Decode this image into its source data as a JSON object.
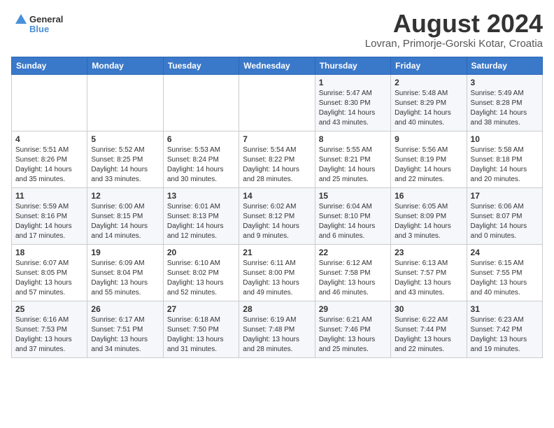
{
  "header": {
    "logo_line1": "General",
    "logo_line2": "Blue",
    "month_year": "August 2024",
    "location": "Lovran, Primorje-Gorski Kotar, Croatia"
  },
  "weekdays": [
    "Sunday",
    "Monday",
    "Tuesday",
    "Wednesday",
    "Thursday",
    "Friday",
    "Saturday"
  ],
  "weeks": [
    [
      {
        "day": "",
        "info": ""
      },
      {
        "day": "",
        "info": ""
      },
      {
        "day": "",
        "info": ""
      },
      {
        "day": "",
        "info": ""
      },
      {
        "day": "1",
        "info": "Sunrise: 5:47 AM\nSunset: 8:30 PM\nDaylight: 14 hours\nand 43 minutes."
      },
      {
        "day": "2",
        "info": "Sunrise: 5:48 AM\nSunset: 8:29 PM\nDaylight: 14 hours\nand 40 minutes."
      },
      {
        "day": "3",
        "info": "Sunrise: 5:49 AM\nSunset: 8:28 PM\nDaylight: 14 hours\nand 38 minutes."
      }
    ],
    [
      {
        "day": "4",
        "info": "Sunrise: 5:51 AM\nSunset: 8:26 PM\nDaylight: 14 hours\nand 35 minutes."
      },
      {
        "day": "5",
        "info": "Sunrise: 5:52 AM\nSunset: 8:25 PM\nDaylight: 14 hours\nand 33 minutes."
      },
      {
        "day": "6",
        "info": "Sunrise: 5:53 AM\nSunset: 8:24 PM\nDaylight: 14 hours\nand 30 minutes."
      },
      {
        "day": "7",
        "info": "Sunrise: 5:54 AM\nSunset: 8:22 PM\nDaylight: 14 hours\nand 28 minutes."
      },
      {
        "day": "8",
        "info": "Sunrise: 5:55 AM\nSunset: 8:21 PM\nDaylight: 14 hours\nand 25 minutes."
      },
      {
        "day": "9",
        "info": "Sunrise: 5:56 AM\nSunset: 8:19 PM\nDaylight: 14 hours\nand 22 minutes."
      },
      {
        "day": "10",
        "info": "Sunrise: 5:58 AM\nSunset: 8:18 PM\nDaylight: 14 hours\nand 20 minutes."
      }
    ],
    [
      {
        "day": "11",
        "info": "Sunrise: 5:59 AM\nSunset: 8:16 PM\nDaylight: 14 hours\nand 17 minutes."
      },
      {
        "day": "12",
        "info": "Sunrise: 6:00 AM\nSunset: 8:15 PM\nDaylight: 14 hours\nand 14 minutes."
      },
      {
        "day": "13",
        "info": "Sunrise: 6:01 AM\nSunset: 8:13 PM\nDaylight: 14 hours\nand 12 minutes."
      },
      {
        "day": "14",
        "info": "Sunrise: 6:02 AM\nSunset: 8:12 PM\nDaylight: 14 hours\nand 9 minutes."
      },
      {
        "day": "15",
        "info": "Sunrise: 6:04 AM\nSunset: 8:10 PM\nDaylight: 14 hours\nand 6 minutes."
      },
      {
        "day": "16",
        "info": "Sunrise: 6:05 AM\nSunset: 8:09 PM\nDaylight: 14 hours\nand 3 minutes."
      },
      {
        "day": "17",
        "info": "Sunrise: 6:06 AM\nSunset: 8:07 PM\nDaylight: 14 hours\nand 0 minutes."
      }
    ],
    [
      {
        "day": "18",
        "info": "Sunrise: 6:07 AM\nSunset: 8:05 PM\nDaylight: 13 hours\nand 57 minutes."
      },
      {
        "day": "19",
        "info": "Sunrise: 6:09 AM\nSunset: 8:04 PM\nDaylight: 13 hours\nand 55 minutes."
      },
      {
        "day": "20",
        "info": "Sunrise: 6:10 AM\nSunset: 8:02 PM\nDaylight: 13 hours\nand 52 minutes."
      },
      {
        "day": "21",
        "info": "Sunrise: 6:11 AM\nSunset: 8:00 PM\nDaylight: 13 hours\nand 49 minutes."
      },
      {
        "day": "22",
        "info": "Sunrise: 6:12 AM\nSunset: 7:58 PM\nDaylight: 13 hours\nand 46 minutes."
      },
      {
        "day": "23",
        "info": "Sunrise: 6:13 AM\nSunset: 7:57 PM\nDaylight: 13 hours\nand 43 minutes."
      },
      {
        "day": "24",
        "info": "Sunrise: 6:15 AM\nSunset: 7:55 PM\nDaylight: 13 hours\nand 40 minutes."
      }
    ],
    [
      {
        "day": "25",
        "info": "Sunrise: 6:16 AM\nSunset: 7:53 PM\nDaylight: 13 hours\nand 37 minutes."
      },
      {
        "day": "26",
        "info": "Sunrise: 6:17 AM\nSunset: 7:51 PM\nDaylight: 13 hours\nand 34 minutes."
      },
      {
        "day": "27",
        "info": "Sunrise: 6:18 AM\nSunset: 7:50 PM\nDaylight: 13 hours\nand 31 minutes."
      },
      {
        "day": "28",
        "info": "Sunrise: 6:19 AM\nSunset: 7:48 PM\nDaylight: 13 hours\nand 28 minutes."
      },
      {
        "day": "29",
        "info": "Sunrise: 6:21 AM\nSunset: 7:46 PM\nDaylight: 13 hours\nand 25 minutes."
      },
      {
        "day": "30",
        "info": "Sunrise: 6:22 AM\nSunset: 7:44 PM\nDaylight: 13 hours\nand 22 minutes."
      },
      {
        "day": "31",
        "info": "Sunrise: 6:23 AM\nSunset: 7:42 PM\nDaylight: 13 hours\nand 19 minutes."
      }
    ]
  ]
}
